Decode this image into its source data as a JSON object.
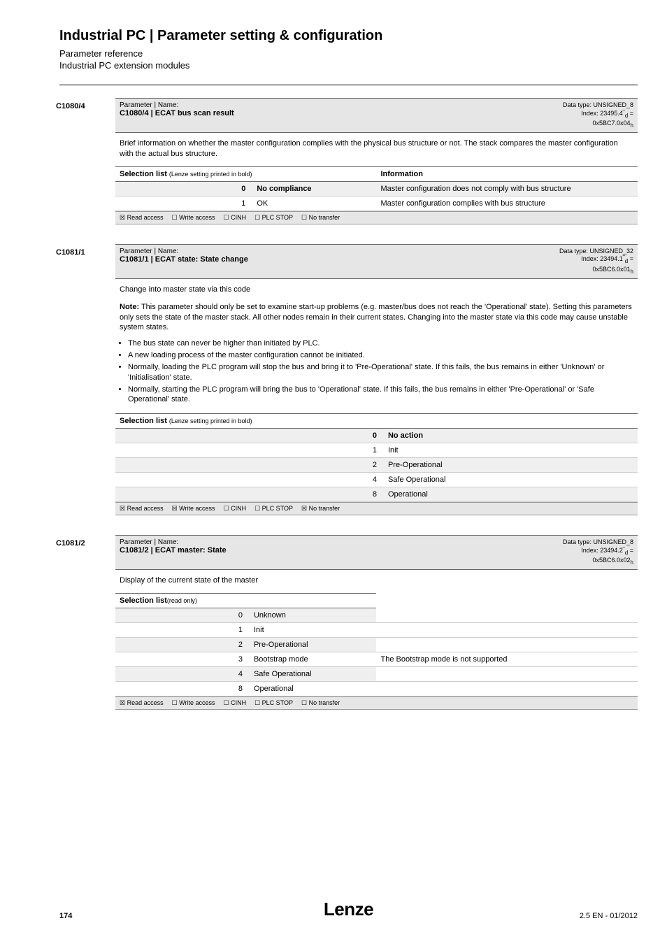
{
  "header": {
    "title": "Industrial PC | Parameter setting & configuration",
    "subtitle1": "Parameter reference",
    "subtitle2": "Industrial PC extension modules"
  },
  "blocks": [
    {
      "code": "C1080/4",
      "param_label": "Parameter | Name:",
      "param_name": "C1080/4 | ECAT bus scan result",
      "meta": {
        "data_type": "Data type: UNSIGNED_8",
        "index": "Index: 23495.4",
        "index_sub": "d",
        "index_eq": " =",
        "hex": "0x5BC7.0x04",
        "hex_sub": "h"
      },
      "desc": "Brief information on whether the master configuration complies with the physical bus structure or not. The stack compares the master configuration with the actual bus structure.",
      "sel_header_a": "Selection list ",
      "sel_header_a_small": "(Lenze setting printed in bold)",
      "sel_header_b": "Information",
      "rows": [
        {
          "n": "0",
          "label": "No compliance",
          "bold": true,
          "info": "Master configuration does not comply with bus structure",
          "alt": true
        },
        {
          "n": "1",
          "label": "OK",
          "bold": false,
          "info": "Master configuration complies with bus structure",
          "alt": false
        }
      ],
      "access": {
        "read": true,
        "write": false,
        "cinh": false,
        "plcstop": false,
        "notransfer": false
      }
    },
    {
      "code": "C1081/1",
      "param_label": "Parameter | Name:",
      "param_name": "C1081/1 | ECAT state: State change",
      "meta": {
        "data_type": "Data type: UNSIGNED_32",
        "index": "Index: 23494.1",
        "index_sub": "d",
        "index_eq": " =",
        "hex": "0x5BC6.0x01",
        "hex_sub": "h"
      },
      "desc": "Change into master state via this code",
      "note_label": "Note:",
      "note_body": " This parameter should only be set to examine start-up problems (e.g. master/bus does not reach the 'Operational' state). Setting this parameters only sets the state of the master stack. All other nodes remain in their current states. Changing into the master state via this code may cause unstable system states.",
      "bullets": [
        "The bus state can never be higher than initiated by PLC.",
        "A new loading process of the master configuration cannot be initiated.",
        "Normally, loading the PLC program will stop the bus and bring it to 'Pre-Operational' state. If this fails, the bus remains in either 'Unknown' or 'Initialisation' state.",
        "Normally, starting the PLC program will bring the bus to 'Operational' state. If this fails, the bus remains in either 'Pre-Operational' or 'Safe Operational' state."
      ],
      "sel_header_a": "Selection list ",
      "sel_header_a_small": "(Lenze setting printed in bold)",
      "rows": [
        {
          "n": "0",
          "label": "No action",
          "bold": true,
          "alt": true
        },
        {
          "n": "1",
          "label": "Init",
          "bold": false,
          "alt": false
        },
        {
          "n": "2",
          "label": "Pre-Operational",
          "bold": false,
          "alt": true
        },
        {
          "n": "4",
          "label": "Safe Operational",
          "bold": false,
          "alt": false
        },
        {
          "n": "8",
          "label": "Operational",
          "bold": false,
          "alt": true
        }
      ],
      "access": {
        "read": true,
        "write": true,
        "cinh": false,
        "plcstop": false,
        "notransfer": true
      }
    },
    {
      "code": "C1081/2",
      "param_label": "Parameter | Name:",
      "param_name": "C1081/2 | ECAT master: State",
      "meta": {
        "data_type": "Data type: UNSIGNED_8",
        "index": "Index: 23494.2",
        "index_sub": "d",
        "index_eq": " =",
        "hex": "0x5BC6.0x02",
        "hex_sub": "h"
      },
      "desc": "Display of the current state of the master",
      "sel_header_a": "Selection list",
      "sel_header_a_small": "(read only)",
      "rows": [
        {
          "n": "0",
          "label": "Unknown",
          "bold": false,
          "info": "",
          "alt": true
        },
        {
          "n": "1",
          "label": "Init",
          "bold": false,
          "info": "",
          "alt": false
        },
        {
          "n": "2",
          "label": "Pre-Operational",
          "bold": false,
          "info": "",
          "alt": true
        },
        {
          "n": "3",
          "label": "Bootstrap mode",
          "bold": false,
          "info": "The Bootstrap mode is not supported",
          "alt": false
        },
        {
          "n": "4",
          "label": "Safe Operational",
          "bold": false,
          "info": "",
          "alt": true
        },
        {
          "n": "8",
          "label": "Operational",
          "bold": false,
          "info": "",
          "alt": false
        }
      ],
      "access": {
        "read": true,
        "write": false,
        "cinh": false,
        "plcstop": false,
        "notransfer": false
      }
    }
  ],
  "access_labels": {
    "read": "Read access",
    "write": "Write access",
    "cinh": "CINH",
    "plcstop": "PLC STOP",
    "notransfer": "No transfer"
  },
  "footer": {
    "page": "174",
    "logo": "Lenze",
    "rev": "2.5 EN - 01/2012"
  }
}
